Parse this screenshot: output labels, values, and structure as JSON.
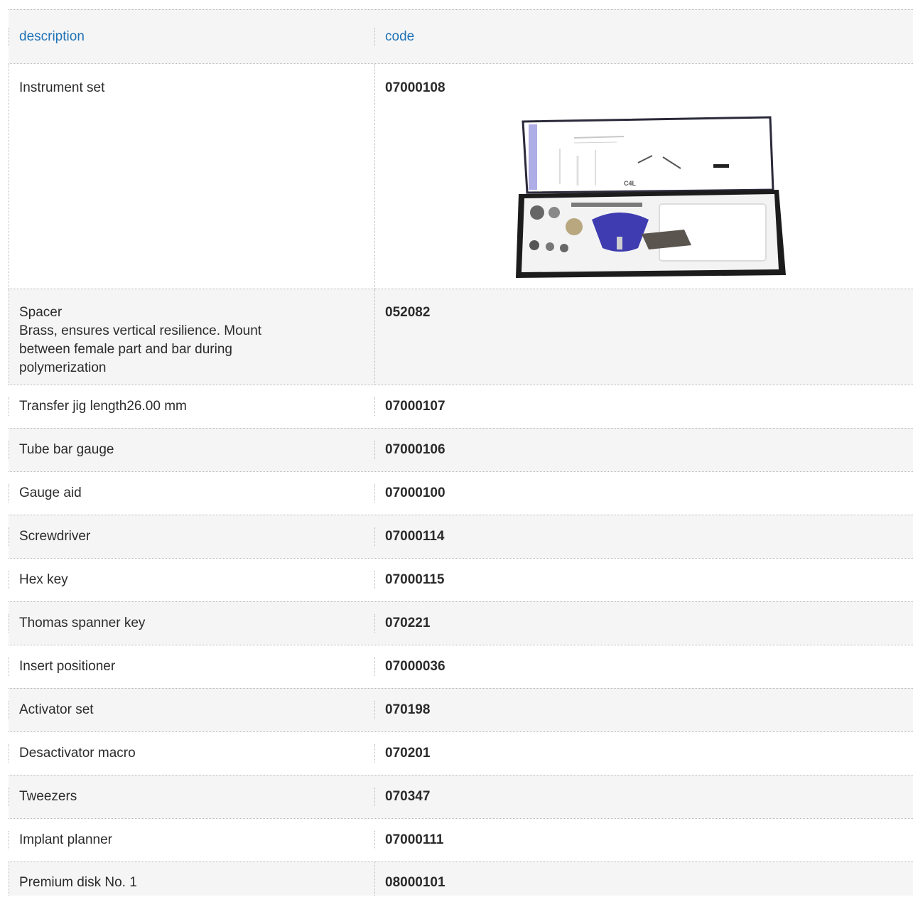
{
  "table": {
    "headers": {
      "description": "description",
      "code": "code"
    },
    "rows": [
      {
        "description": "Instrument set",
        "code": "07000108"
      },
      {
        "description_lines": [
          "Spacer",
          "Brass, ensures vertical resilience. Mount",
          "between female part and bar during",
          "polymerization"
        ],
        "code": "052082"
      },
      {
        "description": "Transfer jig length26.00 mm",
        "code": "07000107"
      },
      {
        "description": "Tube bar gauge",
        "code": "07000106"
      },
      {
        "description": "Gauge aid",
        "code": "07000100"
      },
      {
        "description": "Screwdriver",
        "code": "07000114"
      },
      {
        "description": "Hex key",
        "code": "07000115"
      },
      {
        "description": "Thomas spanner key",
        "code": "070221"
      },
      {
        "description": "Insert positioner",
        "code": "07000036"
      },
      {
        "description": "Activator set",
        "code": "070198"
      },
      {
        "description": "Desactivator macro",
        "code": "070201"
      },
      {
        "description": "Tweezers",
        "code": "070347"
      },
      {
        "description": "Implant planner",
        "code": "07000111"
      },
      {
        "description": "Premium disk No. 1",
        "code": "08000101"
      }
    ]
  },
  "colors": {
    "header_text": "#1f73b7",
    "alt_row_bg": "#f5f5f5",
    "divider": "#b9b9b9"
  },
  "images": {
    "instrument_set": "instrument-set-case-photo"
  }
}
